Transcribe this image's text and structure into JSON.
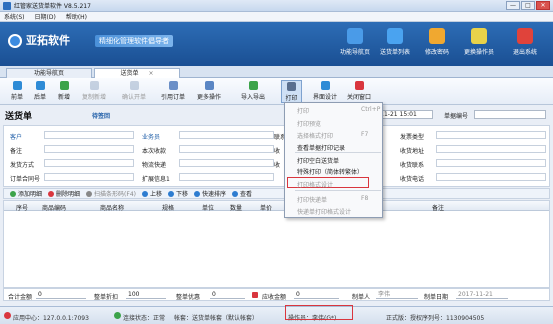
{
  "window": {
    "title": "红管家送货单软件 V8.5.217",
    "min_label": "—",
    "max_label": "□",
    "close_label": "✕"
  },
  "menubar": {
    "items": [
      "系统(S)",
      "日期(D)",
      "帮助(H)"
    ]
  },
  "banner": {
    "brand": "亚拓软件",
    "slogan": "精细化管理软件倡导者",
    "buttons": [
      {
        "label": "功能导航页",
        "icon": "monitor-icon",
        "color": "#4a9be8"
      },
      {
        "label": "送货单列表",
        "icon": "list-monitor-icon",
        "color": "#4aa3f0"
      },
      {
        "label": "修改密码",
        "icon": "lock-icon",
        "color": "#f0a830"
      },
      {
        "label": "更换操作员",
        "icon": "user-switch-icon",
        "color": "#e8d24a"
      },
      {
        "label": "退出系统",
        "icon": "power-icon",
        "color": "#e0433b"
      }
    ]
  },
  "tabs": [
    {
      "label": "功能导航页"
    },
    {
      "label": "送货单",
      "close": "×"
    }
  ],
  "toolbar": {
    "buttons": [
      {
        "label": "前单",
        "icon": "arrow-left-icon"
      },
      {
        "label": "后单",
        "icon": "arrow-right-icon"
      },
      {
        "label": "新增",
        "icon": "add-icon"
      },
      {
        "label": "复制新增",
        "icon": "copy-icon"
      },
      {
        "label": "确认开单",
        "icon": "confirm-icon"
      },
      {
        "label": "引用订单",
        "icon": "reference-icon"
      },
      {
        "label": "更多操作",
        "icon": "more-icon"
      },
      {
        "label": "导入导出",
        "icon": "import-export-icon"
      },
      {
        "label": "打印",
        "icon": "printer-icon"
      },
      {
        "label": "界面设计",
        "icon": "design-icon"
      },
      {
        "label": "关闭窗口",
        "icon": "close-window-icon"
      }
    ]
  },
  "doc": {
    "title": "送货单",
    "status": "待签回",
    "time_value": "-11-21 15:01",
    "doc_no_label": "单据编号"
  },
  "form": {
    "customer": "客户",
    "salesman": "业务员",
    "contact": "联系",
    "receipt_type": "发票类型",
    "note": "备注",
    "current_receivable": "本次收款",
    "receivable_col": "收",
    "delivery_address": "收货地址",
    "shipping_method": "发货方式",
    "logistics_company": "物流快递",
    "delivery_col": "收",
    "receiver_contact": "收货联系",
    "order_contract_no": "订单合同号",
    "extend_info": "扩展信息1",
    "receiver_phone": "收货电话"
  },
  "gridbar": {
    "items": [
      {
        "label": "添加明细",
        "icon": "add-row-icon",
        "color": "#3ca34a"
      },
      {
        "label": "删除明细",
        "icon": "delete-row-icon",
        "color": "#d9363e"
      },
      {
        "label": "扫描条形码(F4)",
        "icon": "barcode-icon",
        "color": "#888"
      },
      {
        "label": "上移",
        "icon": "move-up-icon",
        "color": "#2d7cd0"
      },
      {
        "label": "下移",
        "icon": "move-down-icon",
        "color": "#2d7cd0"
      },
      {
        "label": "快速排序",
        "icon": "sort-icon",
        "color": "#2d7cd0"
      },
      {
        "label": "查看",
        "icon": "view-icon",
        "color": "#2d7cd0"
      }
    ]
  },
  "grid": {
    "columns": [
      "序号",
      "商品编码",
      "商品名称",
      "规格",
      "单位",
      "数量",
      "单价",
      "备注"
    ]
  },
  "totals": {
    "total_amount_label": "合计金额",
    "total_amount_value": "0",
    "order_discount_label": "整单折扣",
    "order_discount_value": "100",
    "order_offer_label": "整单优惠",
    "order_offer_value": "0",
    "receivable_label": "应收金额",
    "receivable_value": "0",
    "maker_label": "制单人",
    "maker_value": "李伟",
    "make_date_label": "制单日期",
    "make_date_value": "2017-11-21"
  },
  "print_menu": {
    "items": [
      {
        "label": "打印",
        "shortcut": "Ctrl+P",
        "disabled": true
      },
      {
        "label": "打印预览",
        "disabled": true
      },
      {
        "label": "选择格式打印",
        "shortcut": "F7",
        "disabled": true
      },
      {
        "label": "查看单据打印记录",
        "disabled": false
      },
      {
        "label": "打印空白送货单",
        "disabled": false
      },
      {
        "label": "特殊打印（简体转繁体）",
        "disabled": false
      },
      {
        "label": "打印格式设计",
        "disabled": true
      },
      {
        "label": "打印快递单",
        "shortcut": "F8",
        "disabled": true
      },
      {
        "label": "快递单打印格式设计",
        "disabled": true
      }
    ]
  },
  "statusbar": {
    "app_center": "应用中心：127.0.0.1:7093",
    "connection": "连接状态：正常",
    "account": "帐套：送货单帐套（默认帐套）",
    "operator": "操作员：李伟(G*)",
    "edition": "正式版：授权序列号：1130904505"
  },
  "colors": {
    "banner": "#1f5ea8",
    "highlight": "#d9363e",
    "link_blue": "#1f5ea8"
  }
}
